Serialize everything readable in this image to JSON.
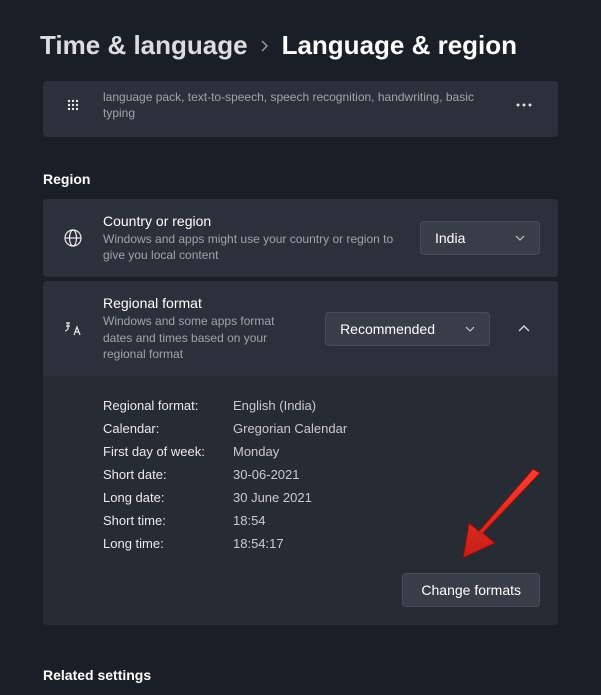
{
  "breadcrumb": {
    "parent": "Time & language",
    "current": "Language & region"
  },
  "langcard": {
    "desc": "language pack, text-to-speech, speech recognition, handwriting, basic typing"
  },
  "section_region": "Region",
  "country": {
    "title": "Country or region",
    "desc": "Windows and apps might use your country or region to give you local content",
    "value": "India"
  },
  "regional": {
    "title": "Regional format",
    "desc": "Windows and some apps format dates and times based on your regional format",
    "value": "Recommended"
  },
  "details": {
    "rows": [
      {
        "label": "Regional format:",
        "value": "English (India)"
      },
      {
        "label": "Calendar:",
        "value": "Gregorian Calendar"
      },
      {
        "label": "First day of week:",
        "value": "Monday"
      },
      {
        "label": "Short date:",
        "value": "30-06-2021"
      },
      {
        "label": "Long date:",
        "value": "30 June 2021"
      },
      {
        "label": "Short time:",
        "value": "18:54"
      },
      {
        "label": "Long time:",
        "value": "18:54:17"
      }
    ],
    "change_btn": "Change formats"
  },
  "section_related": "Related settings"
}
